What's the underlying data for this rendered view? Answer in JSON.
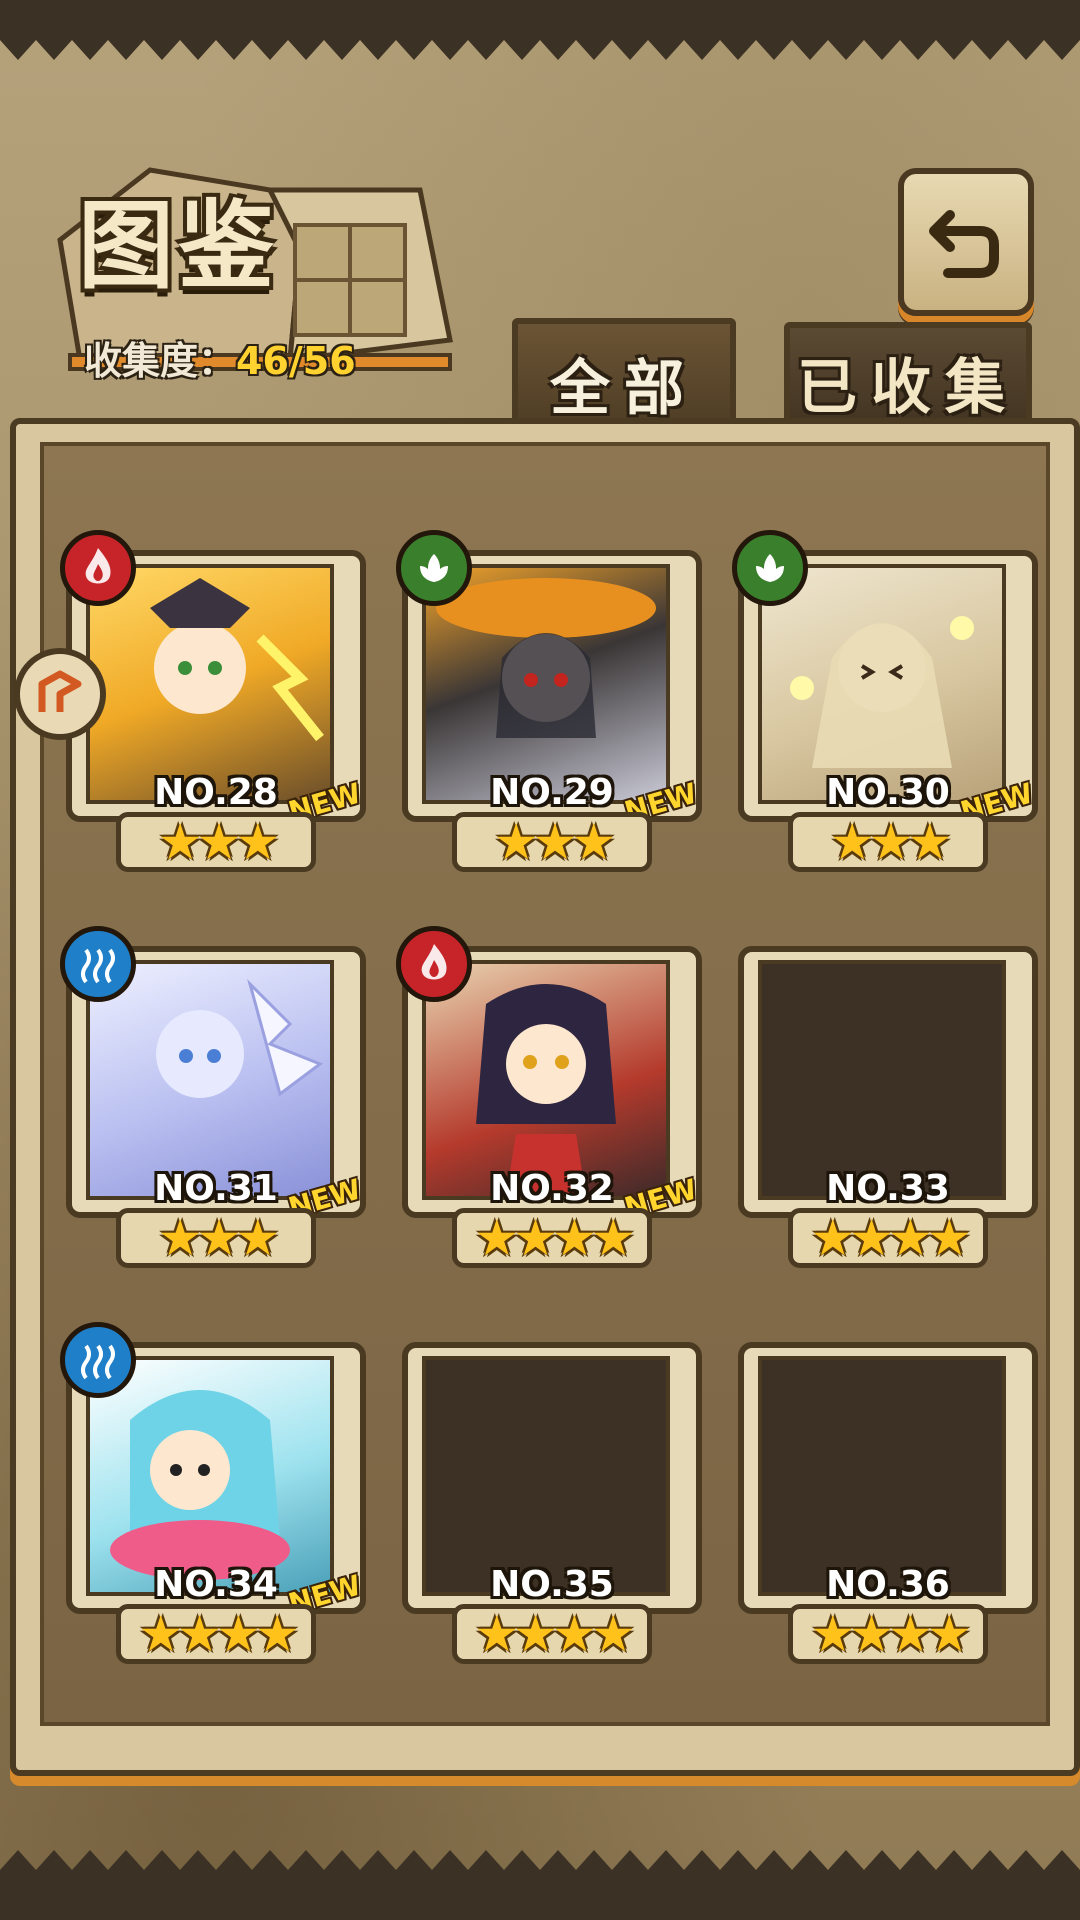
{
  "header": {
    "title": "图鉴",
    "collection_label": "收集度：",
    "collection_value": "46/56"
  },
  "tabs": [
    {
      "label": "全部",
      "active": true
    },
    {
      "label": "已收集",
      "active": false
    }
  ],
  "icons": {
    "back": "return-arrow-icon",
    "side_tab": "arrow-marker-icon"
  },
  "cards": [
    {
      "number": "NO.28",
      "new_label": "NEW",
      "stars": "★★★",
      "element": "fire",
      "collected": true
    },
    {
      "number": "NO.29",
      "new_label": "NEW",
      "stars": "★★★",
      "element": "leaf",
      "collected": true
    },
    {
      "number": "NO.30",
      "new_label": "NEW",
      "stars": "★★★",
      "element": "leaf",
      "collected": true
    },
    {
      "number": "NO.31",
      "new_label": "NEW",
      "stars": "★★★",
      "element": "water",
      "collected": true
    },
    {
      "number": "NO.32",
      "new_label": "NEW",
      "stars": "★★★★",
      "element": "fire",
      "collected": true
    },
    {
      "number": "NO.33",
      "new_label": "",
      "stars": "★★★★",
      "element": "",
      "collected": false
    },
    {
      "number": "NO.34",
      "new_label": "NEW",
      "stars": "★★★★",
      "element": "water",
      "collected": true
    },
    {
      "number": "NO.35",
      "new_label": "",
      "stars": "★★★★",
      "element": "",
      "collected": false
    },
    {
      "number": "NO.36",
      "new_label": "",
      "stars": "★★★★",
      "element": "",
      "collected": false
    }
  ],
  "colors": {
    "fire": "#c62428",
    "leaf": "#3a7f2c",
    "water": "#1f7fc8",
    "accent_gold": "#ffd230",
    "frame_dark": "#4a3a22"
  }
}
